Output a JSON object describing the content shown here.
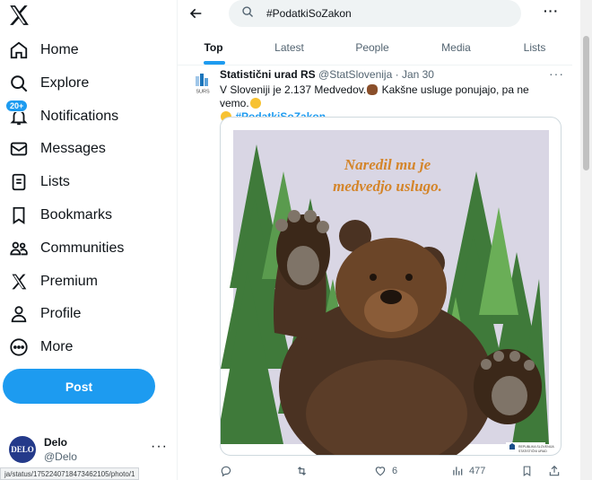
{
  "sidebar": {
    "items": [
      {
        "label": "Home",
        "icon": "home-icon"
      },
      {
        "label": "Explore",
        "icon": "search-icon"
      },
      {
        "label": "Notifications",
        "icon": "bell-icon",
        "badge": "20+"
      },
      {
        "label": "Messages",
        "icon": "envelope-icon"
      },
      {
        "label": "Lists",
        "icon": "list-icon"
      },
      {
        "label": "Bookmarks",
        "icon": "bookmark-icon"
      },
      {
        "label": "Communities",
        "icon": "people-icon"
      },
      {
        "label": "Premium",
        "icon": "x-logo-icon"
      },
      {
        "label": "Profile",
        "icon": "person-icon"
      },
      {
        "label": "More",
        "icon": "more-circle-icon"
      }
    ],
    "post_label": "Post",
    "account": {
      "avatar_text": "DELO",
      "name": "Delo",
      "handle": "@Delo"
    },
    "status_url": "ja/status/1752240718473462105/photo/1"
  },
  "search": {
    "value": "#PodatkiSoZakon"
  },
  "tabs": [
    {
      "label": "Top",
      "active": true
    },
    {
      "label": "Latest"
    },
    {
      "label": "People"
    },
    {
      "label": "Media"
    },
    {
      "label": "Lists"
    }
  ],
  "tweet": {
    "logo_text": "SURS",
    "author": "Statistični urad RS",
    "handle": "@StatSlovenija",
    "separator": "·",
    "date": "Jan 30",
    "text_1": "V Sloveniji je 2.137 Medvedov.",
    "text_2": "Kakšne usluge ponujajo, pa ne vemo.",
    "hashtag": "#PodatkiSoZakon",
    "image": {
      "line_1": "Naredil mu je",
      "line_2": "medvedjo uslugo.",
      "corner_logo_line_1": "REPUBLIKA SLOVENIJA",
      "corner_logo_line_2": "STATISTIČNI URAD"
    },
    "actions": {
      "reply": "",
      "retweet": "",
      "likes": "6",
      "views": "477"
    }
  },
  "colors": {
    "accent": "#1d9bf0",
    "text": "#0f1419",
    "muted": "#536471",
    "image_bg": "#d9d6e4",
    "title_orange": "#d4852a"
  }
}
